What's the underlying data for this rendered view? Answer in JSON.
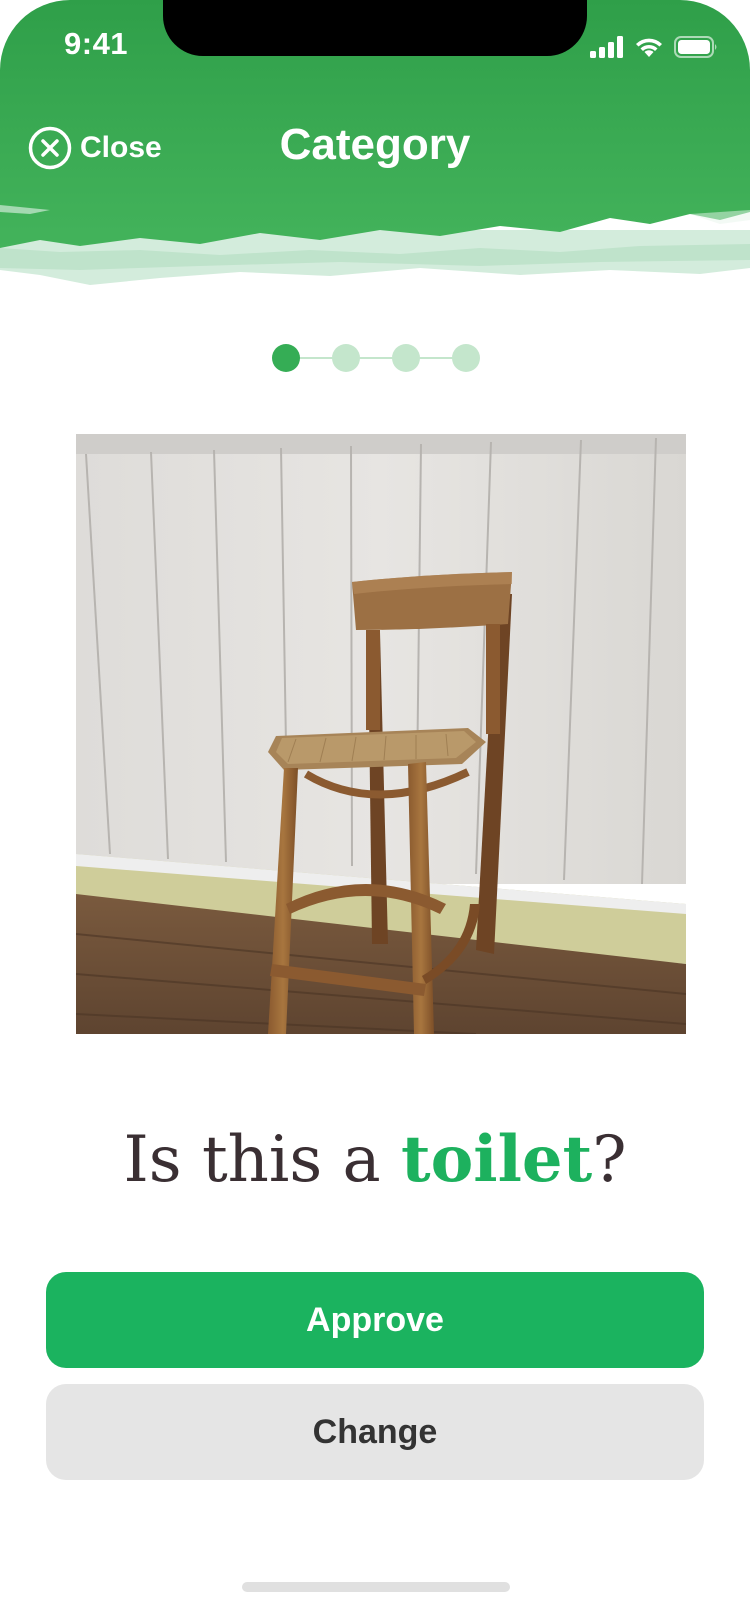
{
  "status_bar": {
    "time": "9:41"
  },
  "nav": {
    "close_label": "Close",
    "title": "Category"
  },
  "stepper": {
    "steps": 4,
    "current": 1
  },
  "question": {
    "prefix": "Is this a ",
    "category": "toilet",
    "suffix": "?"
  },
  "buttons": {
    "approve_label": "Approve",
    "change_label": "Change"
  },
  "colors": {
    "header_green": "#35a853",
    "accent_green": "#1bb35f",
    "stepper_active": "#35ad55",
    "stepper_inactive": "#c4e6cc",
    "secondary_button": "#e5e5e5",
    "question_text": "#3a2f33"
  },
  "icons": {
    "close": "close-circle-icon",
    "signal": "cellular-signal-icon",
    "wifi": "wifi-icon",
    "battery": "battery-icon"
  }
}
